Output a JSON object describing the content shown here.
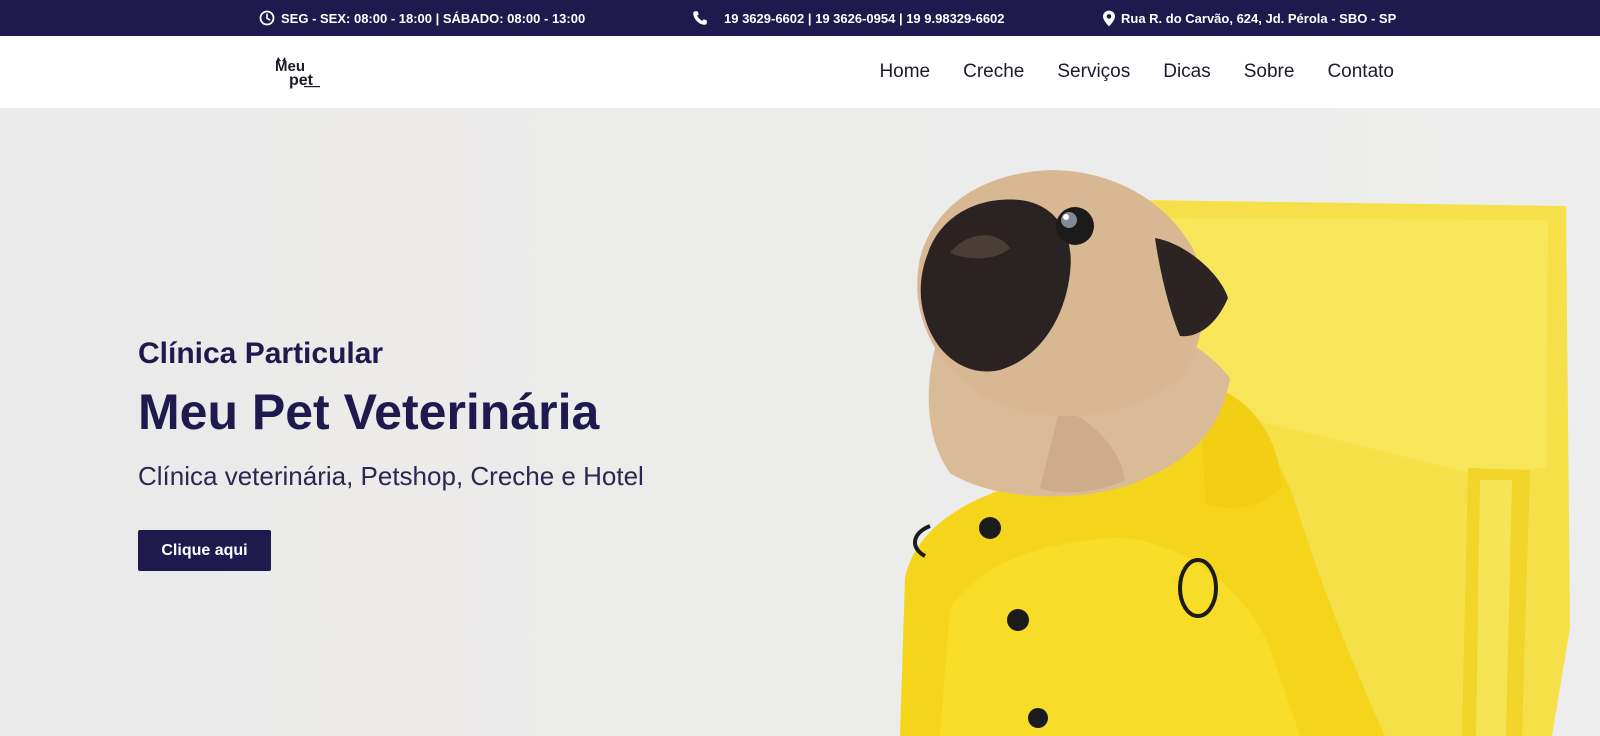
{
  "topbar": {
    "hours": "SEG - SEX: 08:00 - 18:00 | SÁBADO: 08:00 - 13:00",
    "phones": "19 3629-6602 | 19 3626-0954 | 19 9.98329-6602",
    "address": "Rua R. do Carvão, 624, Jd. Pérola - SBO - SP",
    "icons": {
      "hours": "clock-icon",
      "phones": "phone-icon",
      "address": "map-pin-icon"
    }
  },
  "header": {
    "logo_text": [
      "Meu",
      "pet"
    ],
    "nav": [
      "Home",
      "Creche",
      "Serviços",
      "Dicas",
      "Sobre",
      "Contato"
    ]
  },
  "hero": {
    "kicker": "Clínica Particular",
    "title": "Meu Pet Veterinária",
    "subtitle": "Clínica veterinária, Petshop, Creche e Hotel",
    "cta_label": "Clique aqui"
  },
  "colors": {
    "brand": "#1f1a4d",
    "background": "#ececec",
    "accent_yellow": "#f6de22"
  }
}
